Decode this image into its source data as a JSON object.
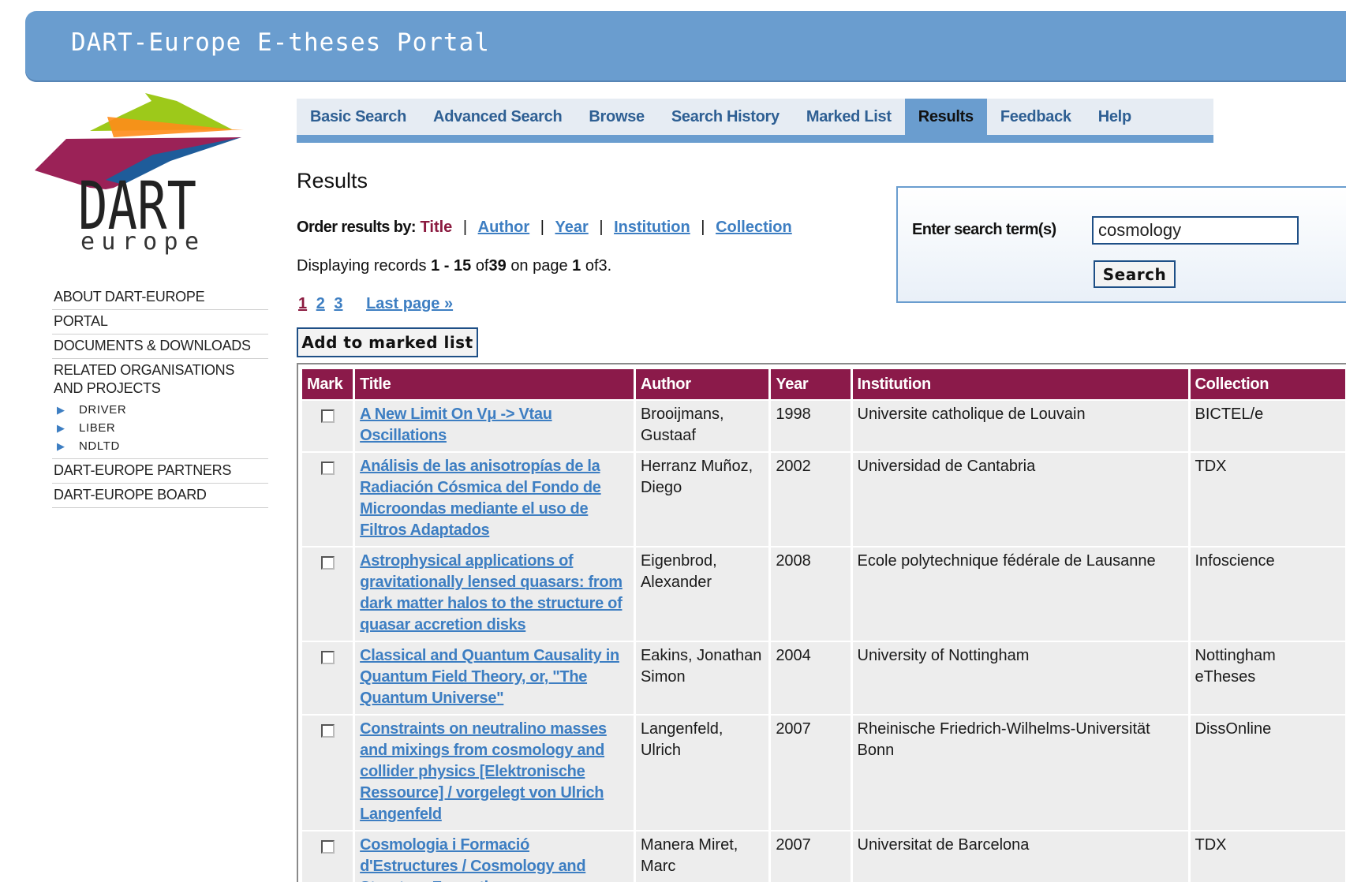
{
  "site": {
    "title": "DART-Europe E-theses Portal",
    "logo_text": "DART",
    "logo_subtext": "europe"
  },
  "sidebar": {
    "items": [
      {
        "label": "ABOUT DART-EUROPE"
      },
      {
        "label": "PORTAL"
      },
      {
        "label": "DOCUMENTS & DOWNLOADS"
      },
      {
        "label": "RELATED ORGANISATIONS"
      },
      {
        "label": "AND PROJECTS"
      },
      {
        "label": "DART-EUROPE PARTNERS"
      },
      {
        "label": "DART-EUROPE BOARD"
      }
    ],
    "subitems": [
      {
        "label": "DRIVER"
      },
      {
        "label": "LIBER"
      },
      {
        "label": "NDLTD"
      }
    ]
  },
  "tabs": [
    {
      "label": "Basic Search"
    },
    {
      "label": "Advanced Search"
    },
    {
      "label": "Browse"
    },
    {
      "label": "Search History"
    },
    {
      "label": "Marked List"
    },
    {
      "label": "Results",
      "active": true
    },
    {
      "label": "Feedback"
    },
    {
      "label": "Help"
    }
  ],
  "main": {
    "heading": "Results",
    "order": {
      "label": "Order results by:",
      "current": "Title",
      "options": [
        "Author",
        "Year",
        "Institution",
        "Collection"
      ],
      "separator": "|"
    },
    "display": {
      "prefix": "Displaying records",
      "from": "1",
      "dash": "-",
      "to": "15",
      "of_label": "of",
      "total": "39",
      "on_page_label": "on page",
      "page": "1",
      "of_pages_label": "of",
      "pages": "3."
    },
    "pager": {
      "current": "1",
      "pages": [
        "2",
        "3"
      ],
      "last_label": "Last page »"
    },
    "add_button": "Add to marked list"
  },
  "search": {
    "label": "Enter search term(s)",
    "value": "cosmology",
    "button": "Search"
  },
  "table": {
    "headers": {
      "mark": "Mark",
      "title": "Title",
      "author": "Author",
      "year": "Year",
      "institution": "Institution",
      "collection": "Collection"
    },
    "rows": [
      {
        "title": "A New Limit On Vμ -> Vtau Oscillations",
        "author": "Brooijmans, Gustaaf",
        "year": "1998",
        "institution": "Universite catholique de Louvain",
        "collection": "BICTEL/e"
      },
      {
        "title": "Análisis de las anisotropías de la Radiación Cósmica del Fondo de Microondas mediante el uso de Filtros Adaptados",
        "author": "Herranz Muñoz, Diego",
        "year": "2002",
        "institution": "Universidad de Cantabria",
        "collection": "TDX"
      },
      {
        "title": "Astrophysical applications of gravitationally lensed quasars: from dark matter halos to the structure of quasar accretion disks",
        "author": "Eigenbrod, Alexander",
        "year": "2008",
        "institution": "Ecole polytechnique fédérale de Lausanne",
        "collection": "Infoscience"
      },
      {
        "title": "Classical and Quantum Causality in Quantum Field Theory, or, \"The Quantum Universe\"",
        "author": "Eakins, Jonathan Simon",
        "year": "2004",
        "institution": "University of Nottingham",
        "collection": "Nottingham eTheses"
      },
      {
        "title": "Constraints on neutralino masses and mixings from cosmology and collider physics [Elektronische Ressource] / vorgelegt von Ulrich Langenfeld",
        "author": "Langenfeld, Ulrich",
        "year": "2007",
        "institution": "Rheinische Friedrich-Wilhelms-Universität Bonn",
        "collection": "DissOnline"
      },
      {
        "title": "Cosmologia i Formació d'Estructures / Cosmology and Structure Formation",
        "author": "Manera Miret, Marc",
        "year": "2007",
        "institution": "Universitat de Barcelona",
        "collection": "TDX"
      }
    ]
  },
  "colors": {
    "banner": "#6a9dcf",
    "header_row": "#8b1a4a",
    "link": "#3d7ec2",
    "current_order": "#8b1a3f",
    "row_bg": "#ededed"
  }
}
